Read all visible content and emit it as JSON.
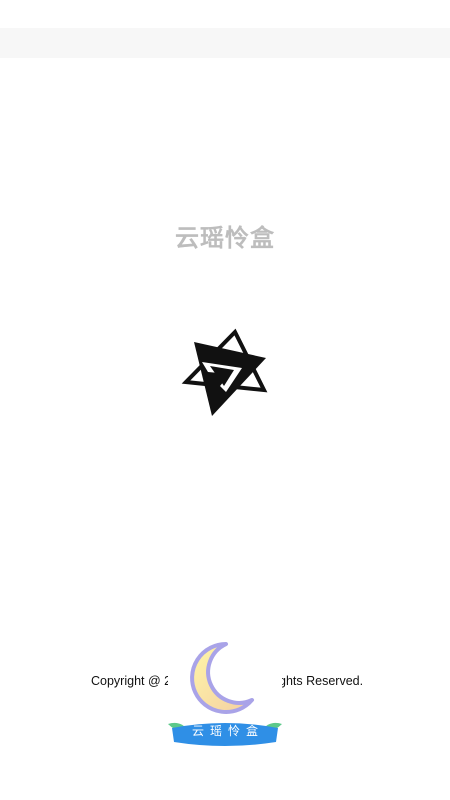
{
  "splash": {
    "app_title": "云瑶怜盒",
    "logo_icon": "hexagram-star-icon"
  },
  "footer": {
    "copyright_start": "Copyright @ 2",
    "copyright_end": "ghts Reserved."
  },
  "badge": {
    "icon": "crescent-moon-icon",
    "label": "云瑶怜盒"
  },
  "colors": {
    "title": "#bdbdbd",
    "band": "#f7f7f7",
    "badge_blue": "#2f8fe6",
    "badge_green": "#5cc98a",
    "moon_fill": "#f6f0a8",
    "moon_outline": "#a9a3e8"
  }
}
